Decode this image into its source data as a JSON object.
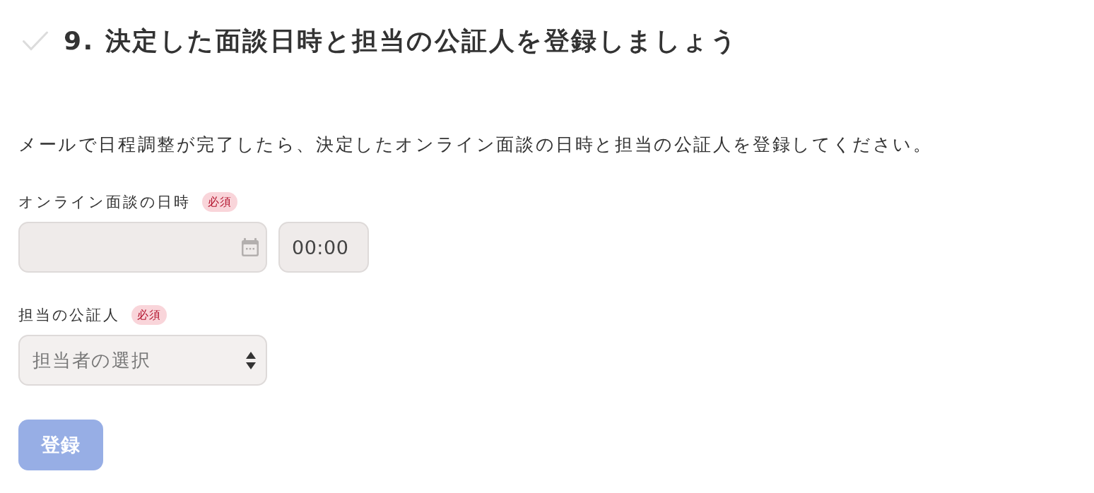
{
  "section": {
    "completed": false,
    "title": "9. 決定した面談日時と担当の公証人を登録しましょう",
    "description": "メールで日程調整が完了したら、決定したオンライン面談の日時と担当の公証人を登録してください。"
  },
  "fields": [
    {
      "kind": "datetime",
      "label": "オンライン面談の日時",
      "badge": "必須",
      "time_value": "00:00"
    },
    {
      "kind": "select",
      "label": "担当の公証人",
      "badge": "必須",
      "placeholder": "担当者の選択"
    }
  ],
  "submit": {
    "label": "登録",
    "disabled": true
  }
}
